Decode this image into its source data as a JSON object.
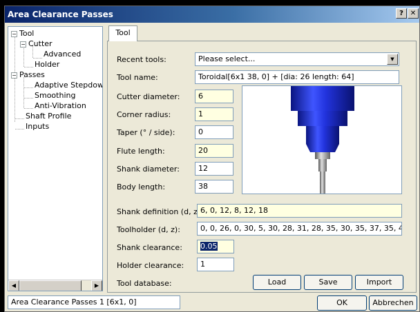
{
  "window": {
    "title": "Area Clearance Passes",
    "help_btn": "?",
    "close_btn": "✕"
  },
  "tree": {
    "items": [
      {
        "label": "Tool",
        "expander": "−"
      },
      {
        "label": "Cutter",
        "expander": "−"
      },
      {
        "label": "Advanced"
      },
      {
        "label": "Holder"
      },
      {
        "label": "Passes",
        "expander": "−"
      },
      {
        "label": "Adaptive Stepdowr"
      },
      {
        "label": "Smoothing"
      },
      {
        "label": "Anti-Vibration"
      },
      {
        "label": "Shaft Profile"
      },
      {
        "label": "Inputs"
      }
    ],
    "scroll_left": "◀",
    "scroll_right": "▶"
  },
  "tab": {
    "label": "Tool"
  },
  "form": {
    "recent_tools": {
      "label": "Recent tools:",
      "value": "Please select...",
      "arrow": "▼"
    },
    "tool_name": {
      "label": "Tool name:",
      "value": "Toroidal[6x1 38, 0] + [dia: 26 length: 64]"
    },
    "cutter_diameter": {
      "label": "Cutter diameter:",
      "value": "6"
    },
    "corner_radius": {
      "label": "Corner radius:",
      "value": "1"
    },
    "taper": {
      "label": "Taper (° / side):",
      "value": "0"
    },
    "flute_length": {
      "label": "Flute length:",
      "value": "20"
    },
    "shank_diameter": {
      "label": "Shank diameter:",
      "value": "12"
    },
    "body_length": {
      "label": "Body length:",
      "value": "38"
    },
    "shank_definition": {
      "label": "Shank definition (d, z):",
      "value": "6, 0, 12, 8, 12, 18"
    },
    "toolholder": {
      "label": "Toolholder (d, z):",
      "value": "0, 0, 26, 0, 30, 5, 30, 28, 31, 28, 35, 30, 35, 37, 35, 40, 39, 4"
    },
    "shank_clearance": {
      "label": "Shank clearance:",
      "value": "0.05"
    },
    "holder_clearance": {
      "label": "Holder clearance:",
      "value": "1"
    },
    "tool_database": {
      "label": "Tool database:"
    }
  },
  "buttons": {
    "load": "Load",
    "save": "Save",
    "import": "Import",
    "ok": "OK",
    "cancel": "Abbrechen"
  },
  "status": {
    "text": "Area Clearance Passes 1 [6x1, 0]"
  },
  "colors": {
    "titlebar": "#0a246a",
    "tool_body": "#1a2ecc",
    "highlight_field": "#ffffe1"
  }
}
